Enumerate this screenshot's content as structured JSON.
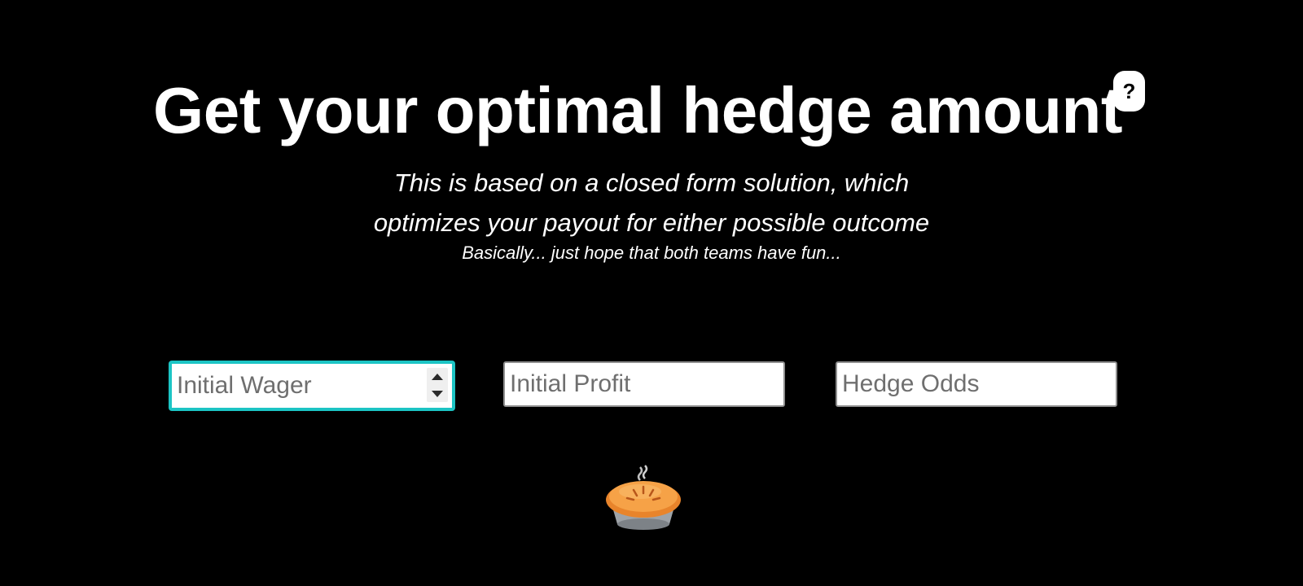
{
  "header": {
    "title": "Get your optimal hedge amount",
    "help_label": "?"
  },
  "intro": {
    "line1": "This is based on a closed form solution, which",
    "line2": "optimizes your payout for either possible outcome",
    "note": "Basically... just hope that both teams have fun..."
  },
  "form": {
    "initial_wager": {
      "value": "",
      "placeholder": "Initial Wager"
    },
    "initial_profit": {
      "value": "",
      "placeholder": "Initial Profit"
    },
    "hedge_odds": {
      "value": "",
      "placeholder": "Hedge Odds"
    }
  },
  "icons": {
    "pie": "pie-icon",
    "help": "question-mark-icon"
  },
  "colors": {
    "background": "#000000",
    "text": "#ffffff",
    "focus_ring": "#1cc4c4",
    "pie_crust": "#f29a3a",
    "pie_tin": "#9ea3a8"
  }
}
